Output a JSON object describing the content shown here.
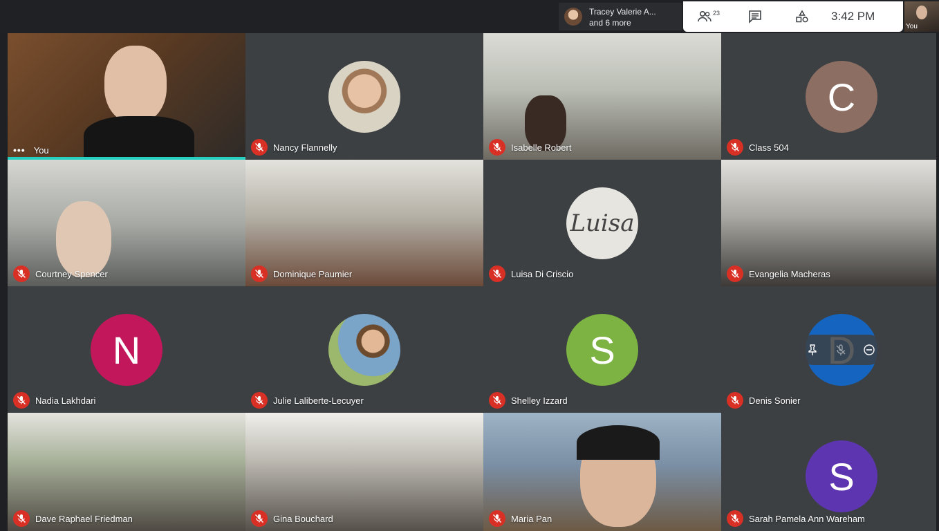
{
  "topbar": {
    "speaker_line1": "Tracey Valerie A...",
    "speaker_line2": "and 6 more",
    "participant_count": "23",
    "time": "3:42 PM",
    "self_label": "You"
  },
  "tiles": [
    {
      "name": "You"
    },
    {
      "name": "Nancy Flannelly"
    },
    {
      "name": "Isabelle Robert"
    },
    {
      "name": "Class 504",
      "initial": "C",
      "color": "#8d6e63"
    },
    {
      "name": "Courtney Spencer"
    },
    {
      "name": "Dominique Paumier"
    },
    {
      "name": "Luisa Di Criscio",
      "avatar_text": "Luisa"
    },
    {
      "name": "Evangelia Macheras"
    },
    {
      "name": "Nadia Lakhdari",
      "initial": "N",
      "color": "#c2185b"
    },
    {
      "name": "Julie Laliberte-Lecuyer"
    },
    {
      "name": "Shelley Izzard",
      "initial": "S",
      "color": "#7cb342"
    },
    {
      "name": "Denis Sonier",
      "initial": "D",
      "color": "#1565c0"
    },
    {
      "name": "Dave Raphael Friedman"
    },
    {
      "name": "Gina Bouchard"
    },
    {
      "name": "Maria Pan"
    },
    {
      "name": "Sarah Pamela Ann Wareham",
      "initial": "S",
      "color": "#5e35b1"
    }
  ]
}
